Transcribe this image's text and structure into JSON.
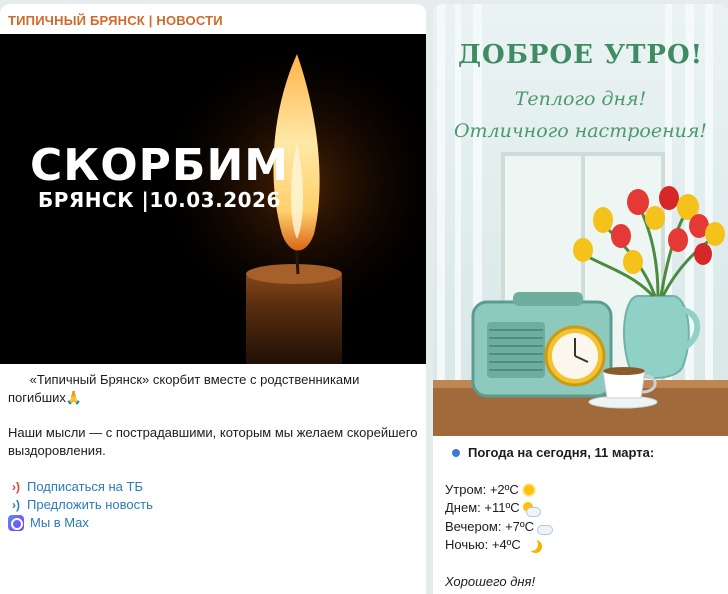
{
  "left_post": {
    "channel_name": "ТИПИЧНЫЙ БРЯНСК | НОВОСТИ",
    "image": {
      "title": "СКОРБИМ",
      "subtitle": "БРЯНСК |10.03.2026"
    },
    "paragraph1": "      «Типичный Брянск» скорбит вместе с родственниками погибших🙏",
    "paragraph2": "Наши мысли — с пострадавшими, которым мы желаем скорейшего выздоровления.",
    "links": [
      {
        "icon": "red-waves-icon",
        "glyph": "›)",
        "label": "Подписаться на ТБ"
      },
      {
        "icon": "blue-waves-icon",
        "glyph": "›)",
        "label": "Предложить новость"
      },
      {
        "icon": "max-app-icon",
        "label": "Мы в Max"
      }
    ]
  },
  "right_post": {
    "image": {
      "title": "ДОБРОЕ УТРО!",
      "line1": "Теплого дня!",
      "line2": "Отличного настроения!"
    },
    "weather": {
      "header": "Погода на сегодня, 11 марта:",
      "morning": "Утром: +2ºC",
      "day": "Днем: +11ºC",
      "evening": "Вечером: +7ºC",
      "night": "Ночью: +4ºC",
      "closing": "Хорошего дня!"
    }
  },
  "colors": {
    "channel_accent": "#d0692a",
    "link": "#2a7bbd",
    "greeting_green": "#3f8b62",
    "page_bg": "#e6ebee"
  }
}
